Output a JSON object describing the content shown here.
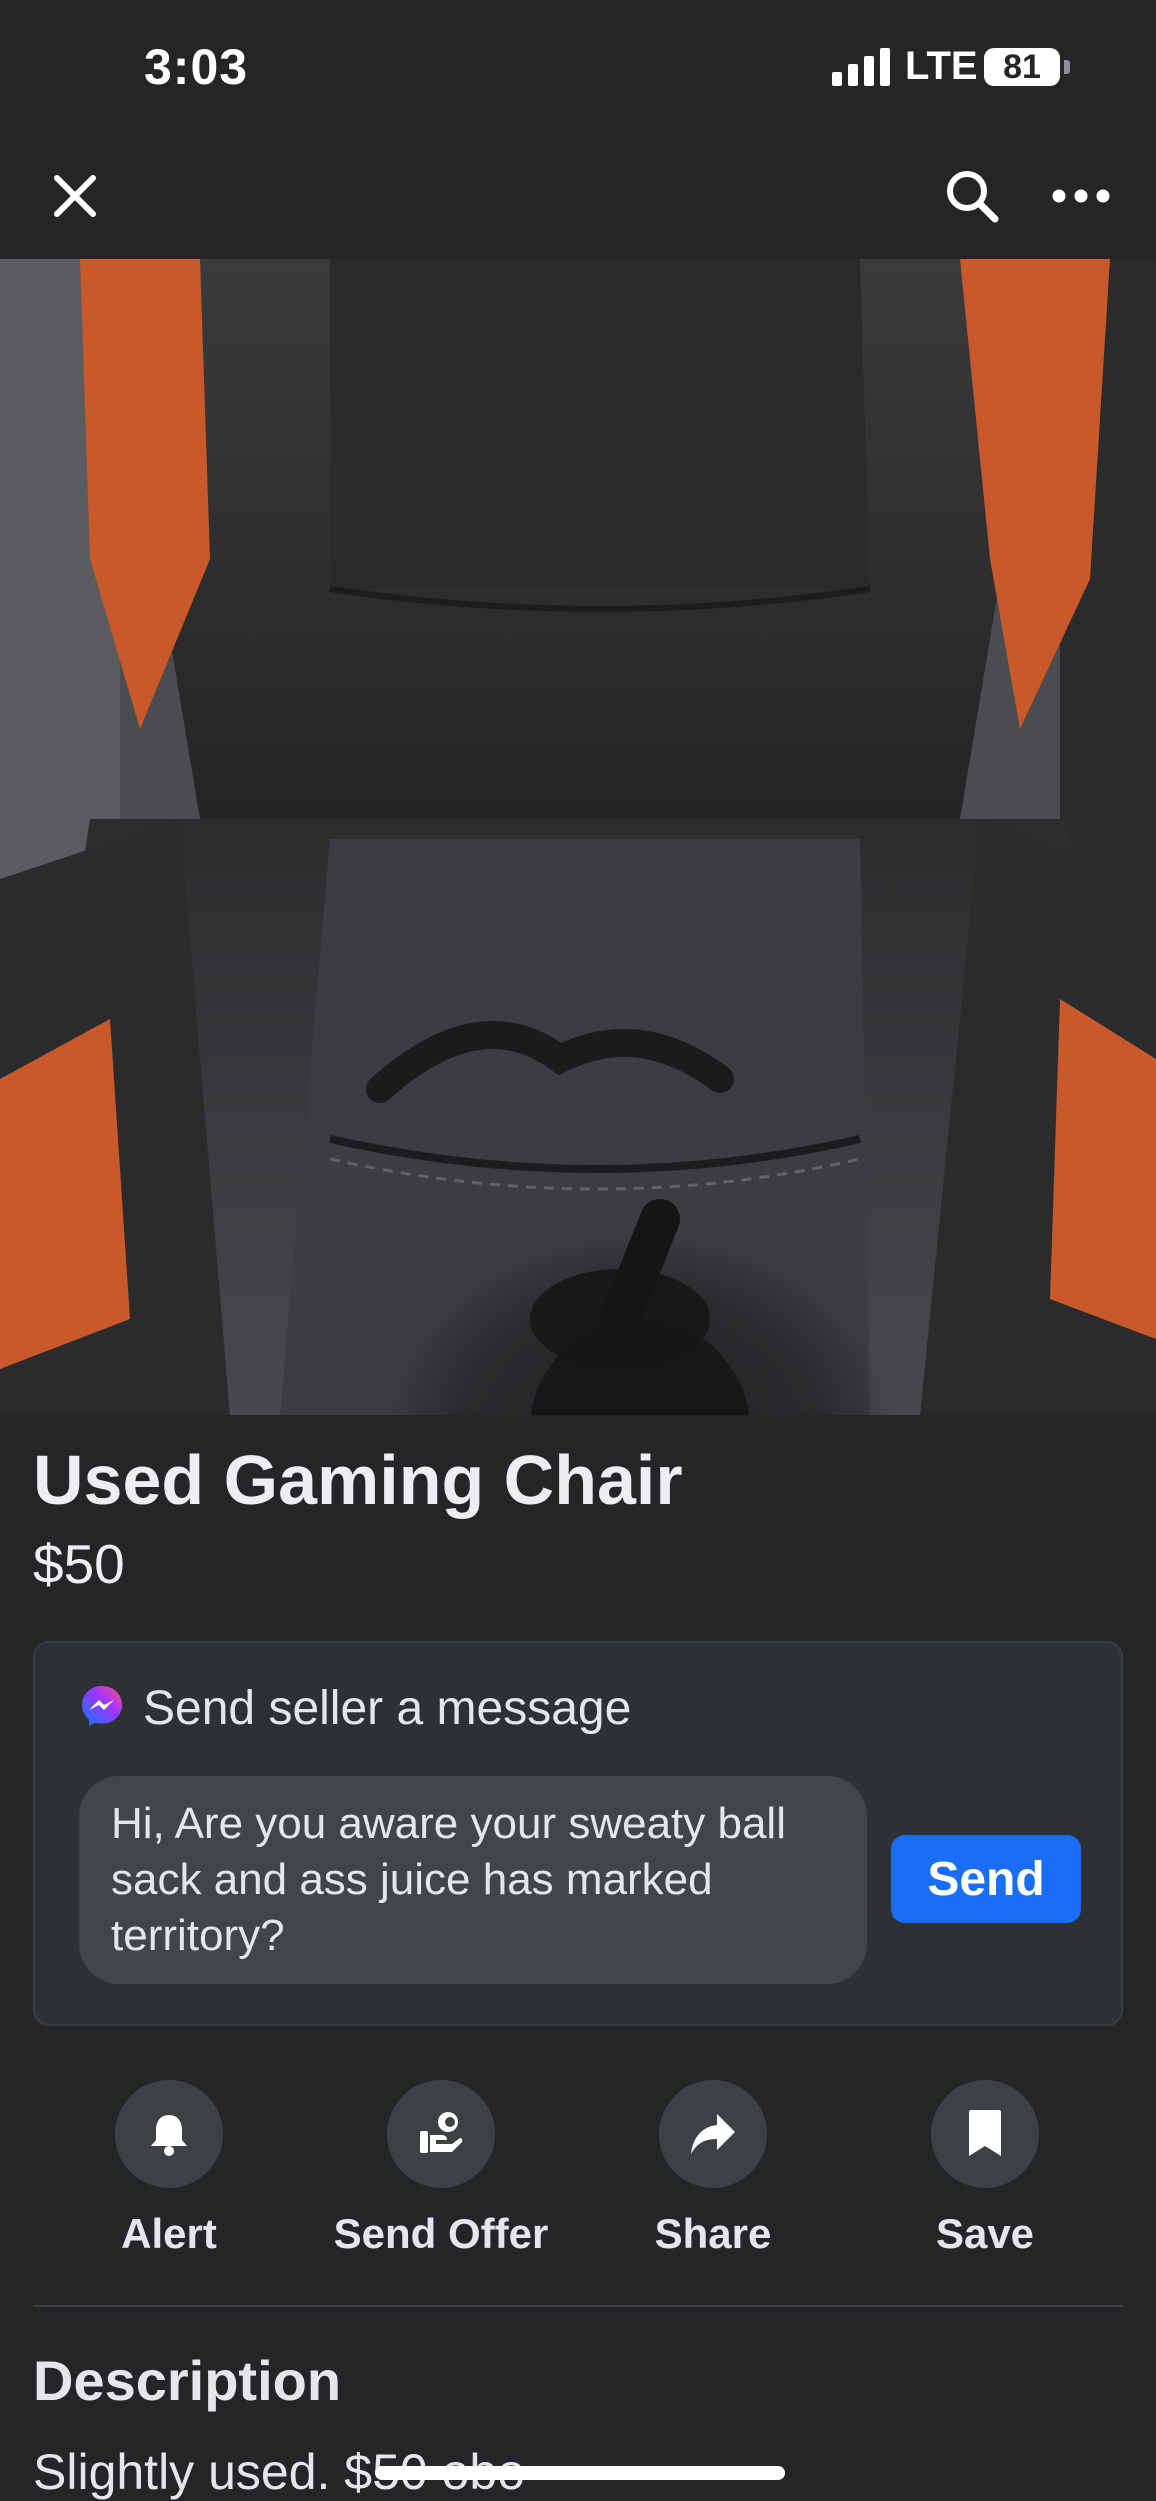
{
  "status_bar": {
    "time": "3:03",
    "network": "LTE",
    "battery": "81"
  },
  "nav": {
    "close_icon": "close-icon",
    "search_icon": "search-icon",
    "more_icon": "more-horizontal-icon"
  },
  "listing": {
    "title": "Used Gaming Chair",
    "price": "$50"
  },
  "message": {
    "header": "Send seller a message",
    "input_value": "Hi, Are you aware your sweaty ball sack and ass juice has marked territory?",
    "send_label": "Send"
  },
  "actions": [
    {
      "label": "Alert",
      "icon": "bell-icon"
    },
    {
      "label": "Send Offer",
      "icon": "offer-hand-icon"
    },
    {
      "label": "Share",
      "icon": "share-arrow-icon"
    },
    {
      "label": "Save",
      "icon": "bookmark-icon"
    }
  ],
  "description": {
    "heading": "Description",
    "text": "Slightly used. $50 obo"
  },
  "colors": {
    "background": "#232527",
    "accent": "#1a6ef5",
    "card": "#2e3134"
  }
}
